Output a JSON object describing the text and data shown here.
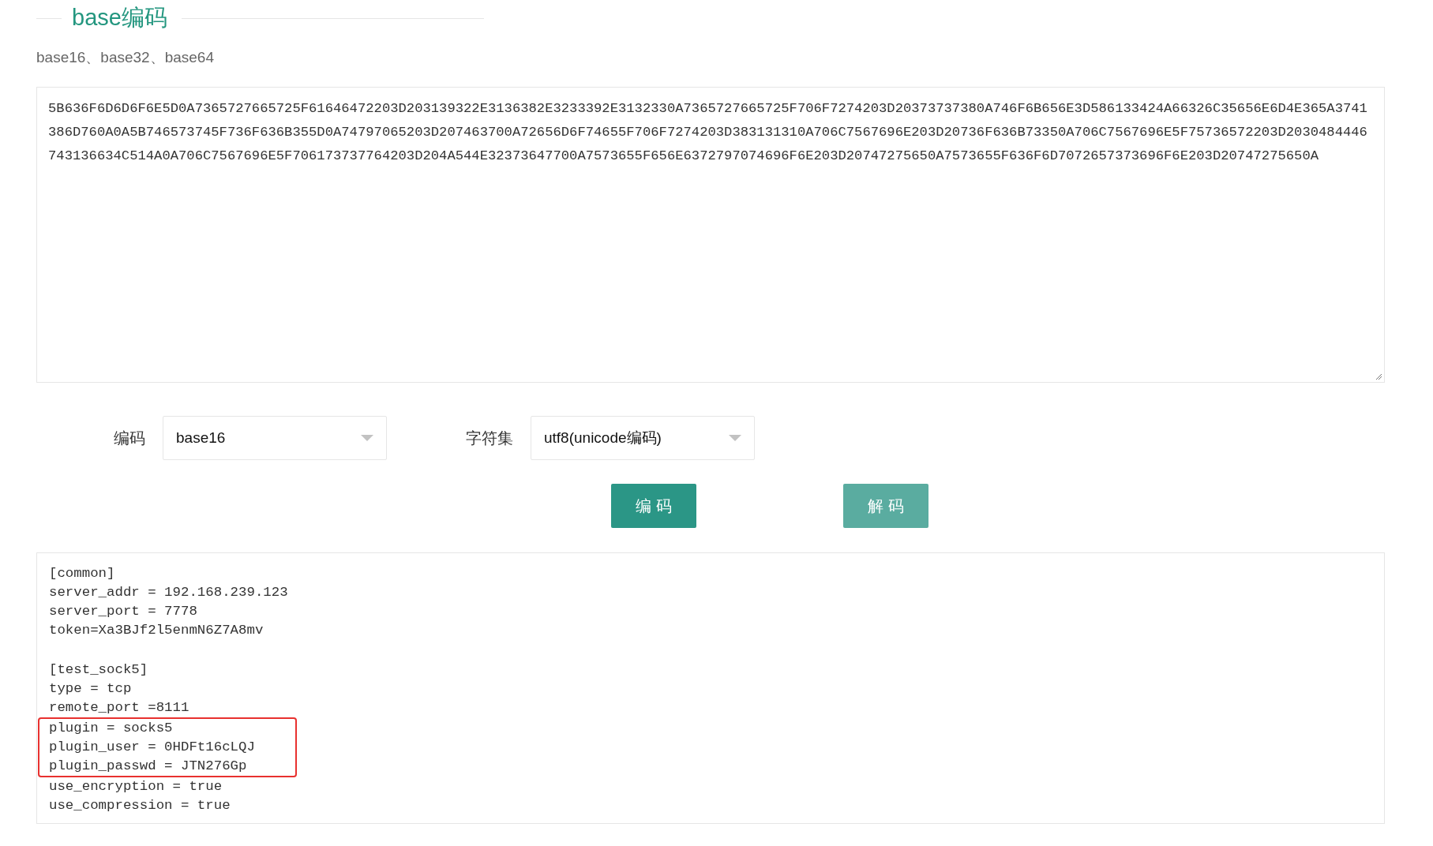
{
  "header": {
    "title": "base编码",
    "subtitle": "base16、base32、base64"
  },
  "input": {
    "value": "5B636F6D6D6F6E5D0A7365727665725F61646472203D203139322E3136382E3233392E3132330A7365727665725F706F7274203D20373737380A746F6B656E3D586133424A66326C35656E6D4E365A3741386D760A0A5B746573745F736F636B355D0A74797065203D207463700A72656D6F74655F706F7274203D383131310A706C7567696E203D20736F636B73350A706C7567696E5F75736572203D2030484446743136634C514A0A706C7567696E5F706173737764203D204A544E32373647700A7573655F656E6372797074696F6E203D20747275650A7573655F636F6D7072657373696F6E203D20747275650A"
  },
  "options": [
    {
      "label": "编码",
      "value": "base16"
    },
    {
      "label": "字符集",
      "value": "utf8(unicode编码)"
    }
  ],
  "buttons": [
    {
      "label": "编 码",
      "kind": "primary"
    },
    {
      "label": "解 码",
      "kind": "secondary"
    }
  ],
  "output": {
    "sections": [
      {
        "blocks": [
          {
            "highlighted": false,
            "lines": [
              "[common]",
              "server_addr = 192.168.239.123",
              "server_port = 7778",
              "token=Xa3BJf2l5enmN6Z7A8mv"
            ]
          }
        ]
      },
      {
        "blocks": [
          {
            "highlighted": false,
            "lines": [
              "[test_sock5]",
              "type = tcp",
              "remote_port =8111"
            ]
          },
          {
            "highlighted": true,
            "lines": [
              "plugin = socks5",
              "plugin_user = 0HDFt16cLQJ",
              "plugin_passwd = JTN276Gp"
            ]
          },
          {
            "highlighted": false,
            "lines": [
              "use_encryption = true",
              "use_compression = true"
            ]
          }
        ]
      }
    ]
  }
}
